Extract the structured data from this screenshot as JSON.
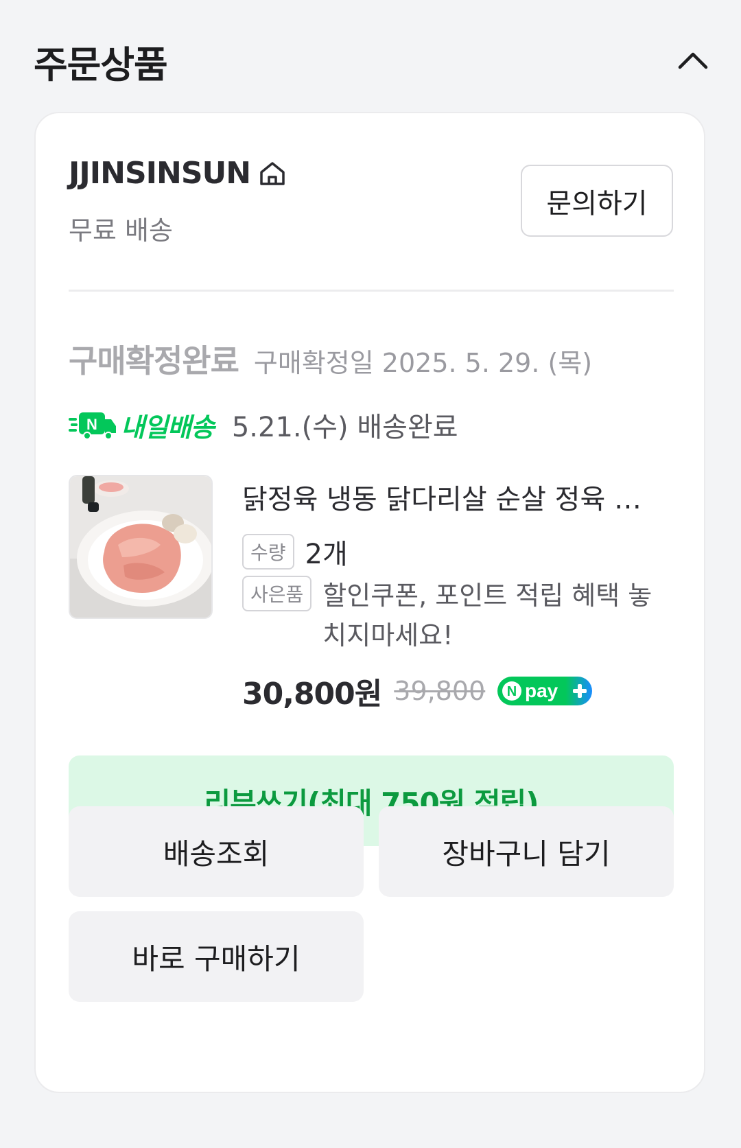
{
  "header": {
    "title": "주문상품"
  },
  "seller": {
    "name": "JJINSINSUN",
    "shipping": "무료 배송",
    "inquiry_label": "문의하기"
  },
  "order": {
    "status": "구매확정완료",
    "confirm_date": "구매확정일 2025. 5. 29. (목)",
    "delivery_badge": "내일배송",
    "delivery_badge_logo": "N",
    "delivery_status": "5.21.(수) 배송완료"
  },
  "product": {
    "title": "닭정육 냉동 닭다리살 순살 정육 …",
    "quantity_tag": "수량",
    "quantity": "2개",
    "gift_tag": "사은품",
    "gift_text": "할인쿠폰, 포인트 적립 혜택 놓치지마세요!",
    "price": "30,800원",
    "original_price": "39,800",
    "npay_label": "pay",
    "npay_logo": "N"
  },
  "actions": {
    "review": "리뷰쓰기(최대 750원 적립)",
    "track": "배송조회",
    "cart": "장바구니 담기",
    "buy_now": "바로 구매하기"
  },
  "colors": {
    "brand_green": "#03c75a",
    "review_bg": "#dcf8e6",
    "review_text": "#0c9a3f",
    "npay_blue": "#1a8cff"
  },
  "icons": {
    "collapse": "chevron-up-icon",
    "store": "home-icon",
    "delivery": "delivery-truck-icon"
  }
}
